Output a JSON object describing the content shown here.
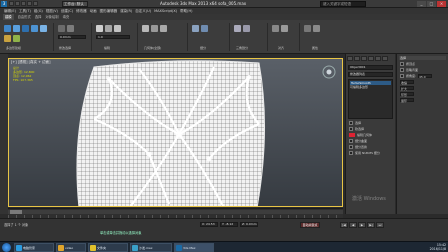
{
  "window": {
    "title": "Autodesk 3ds Max 2013 x64    sofa_005.max",
    "logo": "3",
    "workspace": "工作台: 默认",
    "search_placeholder": "键入关键字或短语",
    "controls": [
      "_",
      "□",
      "×"
    ]
  },
  "menu": [
    "编辑(E)",
    "工具(T)",
    "组(G)",
    "视图(V)",
    "创建(C)",
    "修改器",
    "动画",
    "图形编辑器",
    "渲染(R)",
    "自定义(U)",
    "MAXScript(X)",
    "帮助(H)"
  ],
  "ribbon": {
    "tabs": [
      "建模",
      "自由形式",
      "选择",
      "对象绘制",
      "填充"
    ],
    "active_tab": "建模",
    "groups": [
      {
        "label": "多边形建模"
      },
      {
        "label": "修改选择"
      },
      {
        "label": "编辑"
      },
      {
        "label": "几何体(全部)"
      },
      {
        "label": "细分"
      },
      {
        "label": "三角剖分"
      },
      {
        "label": "对齐"
      },
      {
        "label": "属性"
      }
    ],
    "field_value": "0.0mm",
    "field_value2": "1.0"
  },
  "viewport": {
    "label": "[+] [透视] [真实 + 边面]",
    "stats": [
      "总计",
      "多边形: 12,800",
      "顶点: 12,962"
    ],
    "fps": "FPS: 107.365"
  },
  "command_panel": {
    "object_name": "Object001",
    "modifier_list": "修改器列表",
    "stack": [
      "TurboSmooth",
      "可编辑多边形"
    ],
    "rows": [
      "选择",
      "软选择",
      "编辑几何体",
      "细分曲面",
      "细分置换"
    ],
    "checkbox_label": "使用 NURMS 细分"
  },
  "right_panel": {
    "title": "选择",
    "rows": [
      "按顶点",
      "忽略背面",
      "按角度:",
      "收缩",
      "扩大",
      "环形",
      "循环"
    ],
    "value": "45.0"
  },
  "timeline": {
    "position": "0 / 100"
  },
  "status": {
    "selected": "选择了 1 个 对象",
    "hint": "单击或单击并拖动以选择对象",
    "coords": [
      "X: 24.53",
      "Y: -8.12",
      "Z: 0.0mm"
    ],
    "grid": "栅格 = 10.0mm",
    "autokey": "自动关键点",
    "anim_buttons": [
      "|◀",
      "◀",
      "▶",
      "▶|",
      "⏭"
    ]
  },
  "watermark": "激活 Windows",
  "taskbar": {
    "tasks": [
      {
        "label": "电脑管家",
        "color": "#2b9be0"
      },
      {
        "label": "video",
        "color": "#e0a42b"
      },
      {
        "label": "文件夹",
        "color": "#e0c02b"
      },
      {
        "label": "沙发.max",
        "color": "#3aa0c8"
      },
      {
        "label": "3ds Max",
        "color": "#1b6aa5"
      }
    ],
    "time": "15:42",
    "date": "2016/11/8"
  }
}
